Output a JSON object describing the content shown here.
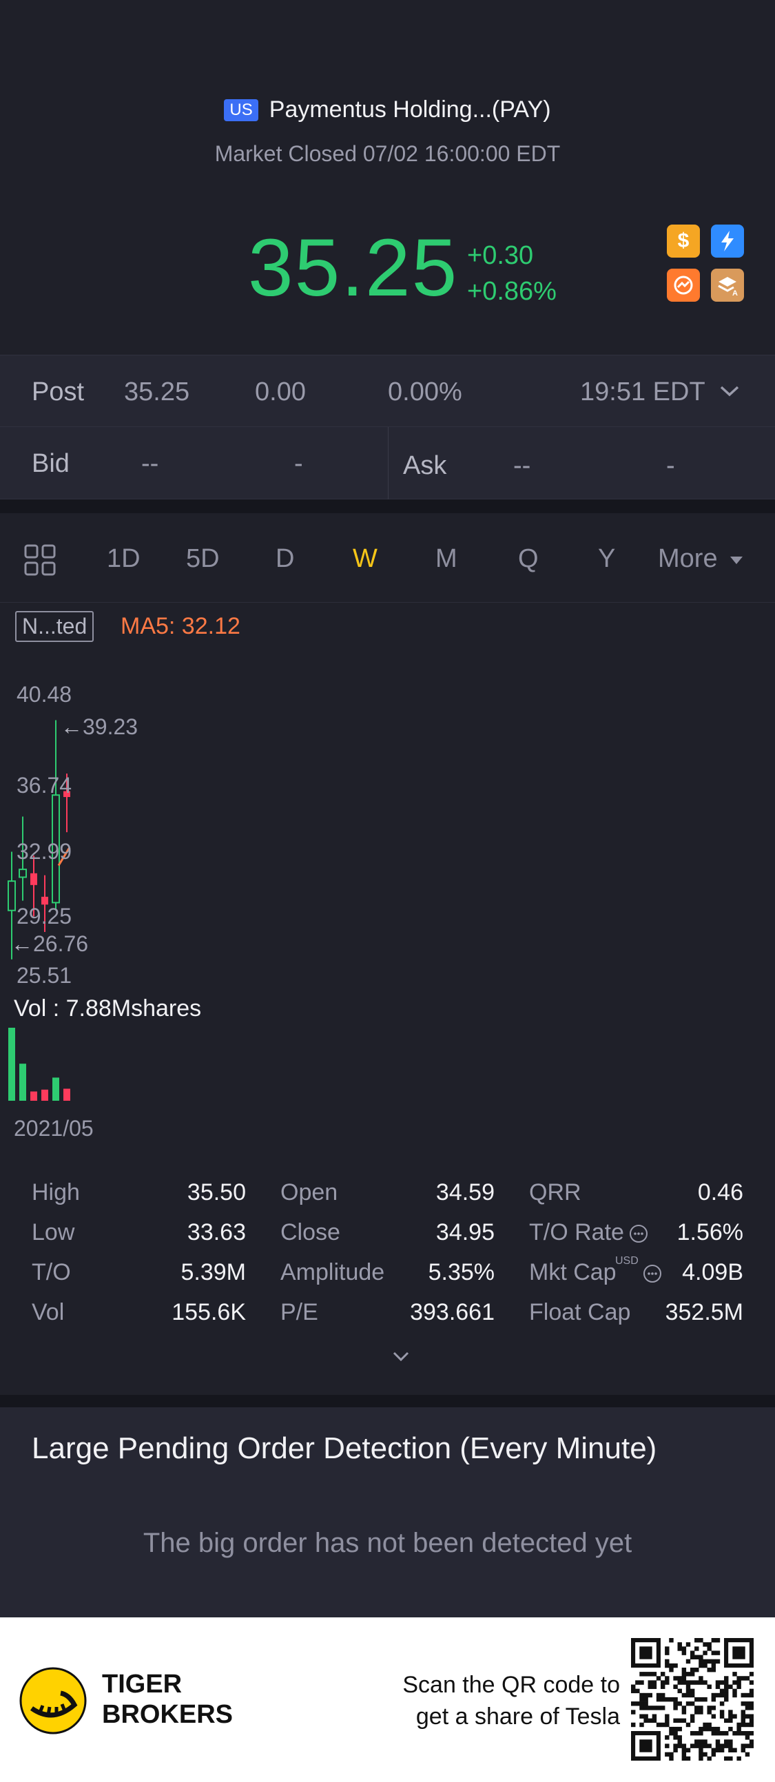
{
  "header": {
    "flag": "US",
    "stock_name": "Paymentus Holding...(PAY)",
    "market_status": "Market Closed 07/02 16:00:00 EDT",
    "price": "35.25",
    "change": "+0.30",
    "change_pct": "+0.86%",
    "accent_color": "#2ecc71"
  },
  "post": {
    "label": "Post",
    "price": "35.25",
    "change": "0.00",
    "change_pct": "0.00%",
    "time": "19:51 EDT"
  },
  "bid": {
    "label": "Bid",
    "price": "--",
    "size": "-",
    "ask_label": "Ask",
    "ask_price": "--",
    "ask_size": "-"
  },
  "tabs": [
    "1D",
    "5D",
    "D",
    "W",
    "M",
    "Q",
    "Y"
  ],
  "active_tab": "W",
  "more_label": "More",
  "chart": {
    "adjust_label": "N...ted",
    "ma5_label": "MA5: 32.12",
    "price_labels": [
      "40.48",
      "36.74",
      "32.99",
      "29.25",
      "25.51"
    ],
    "high_marker": "39.23",
    "low_marker": "26.76",
    "volume_label": "Vol  : 7.88Mshares",
    "date_label": "2021/05"
  },
  "chart_data": {
    "type": "candlestick",
    "y_ticks": [
      40.48,
      36.74,
      32.99,
      29.25,
      25.51
    ],
    "ylim": [
      25.51,
      40.48
    ],
    "candles": [
      {
        "open": 29.5,
        "close": 31.0,
        "high": 32.5,
        "low": 27.0,
        "color": "up"
      },
      {
        "open": 31.2,
        "close": 31.6,
        "high": 34.3,
        "low": 30.0,
        "color": "up"
      },
      {
        "open": 31.4,
        "close": 30.8,
        "high": 32.3,
        "low": 29.2,
        "color": "down"
      },
      {
        "open": 30.2,
        "close": 29.8,
        "high": 31.3,
        "low": 28.4,
        "color": "down"
      },
      {
        "open": 29.9,
        "close": 35.4,
        "high": 39.23,
        "low": 29.5,
        "color": "up"
      },
      {
        "open": 35.6,
        "close": 35.3,
        "high": 36.5,
        "low": 33.5,
        "color": "down"
      }
    ],
    "ma5": [
      31.8,
      32.12
    ],
    "volumes": [
      7.88,
      4.0,
      1.0,
      1.2,
      2.5,
      1.3
    ],
    "volume_colors": [
      "up",
      "up",
      "down",
      "down",
      "up",
      "down"
    ]
  },
  "stats": [
    [
      {
        "label": "High",
        "value": "35.50"
      },
      {
        "label": "Open",
        "value": "34.59"
      },
      {
        "label": "QRR",
        "value": "0.46"
      }
    ],
    [
      {
        "label": "Low",
        "value": "33.63"
      },
      {
        "label": "Close",
        "value": "34.95"
      },
      {
        "label": "T/O Rate",
        "value": "1.56%"
      }
    ],
    [
      {
        "label": "T/O",
        "value": "5.39M"
      },
      {
        "label": "Amplitude",
        "value": "5.35%"
      },
      {
        "label": "Mkt Cap",
        "value": "4.09B"
      }
    ],
    [
      {
        "label": "Vol",
        "value": "155.6K"
      },
      {
        "label": "P/E",
        "value": "393.661"
      },
      {
        "label": "Float Cap",
        "value": "352.5M"
      }
    ]
  ],
  "mkt_cap_currency": "USD",
  "large_order": {
    "title": "Large Pending Order Detection (Every Minute)",
    "empty_text": "The big order has not been detected yet"
  },
  "footer": {
    "brand_line1": "TIGER",
    "brand_line2": "BROKERS",
    "scan_line1": "Scan the QR code to",
    "scan_line2": "get a share of Tesla"
  }
}
